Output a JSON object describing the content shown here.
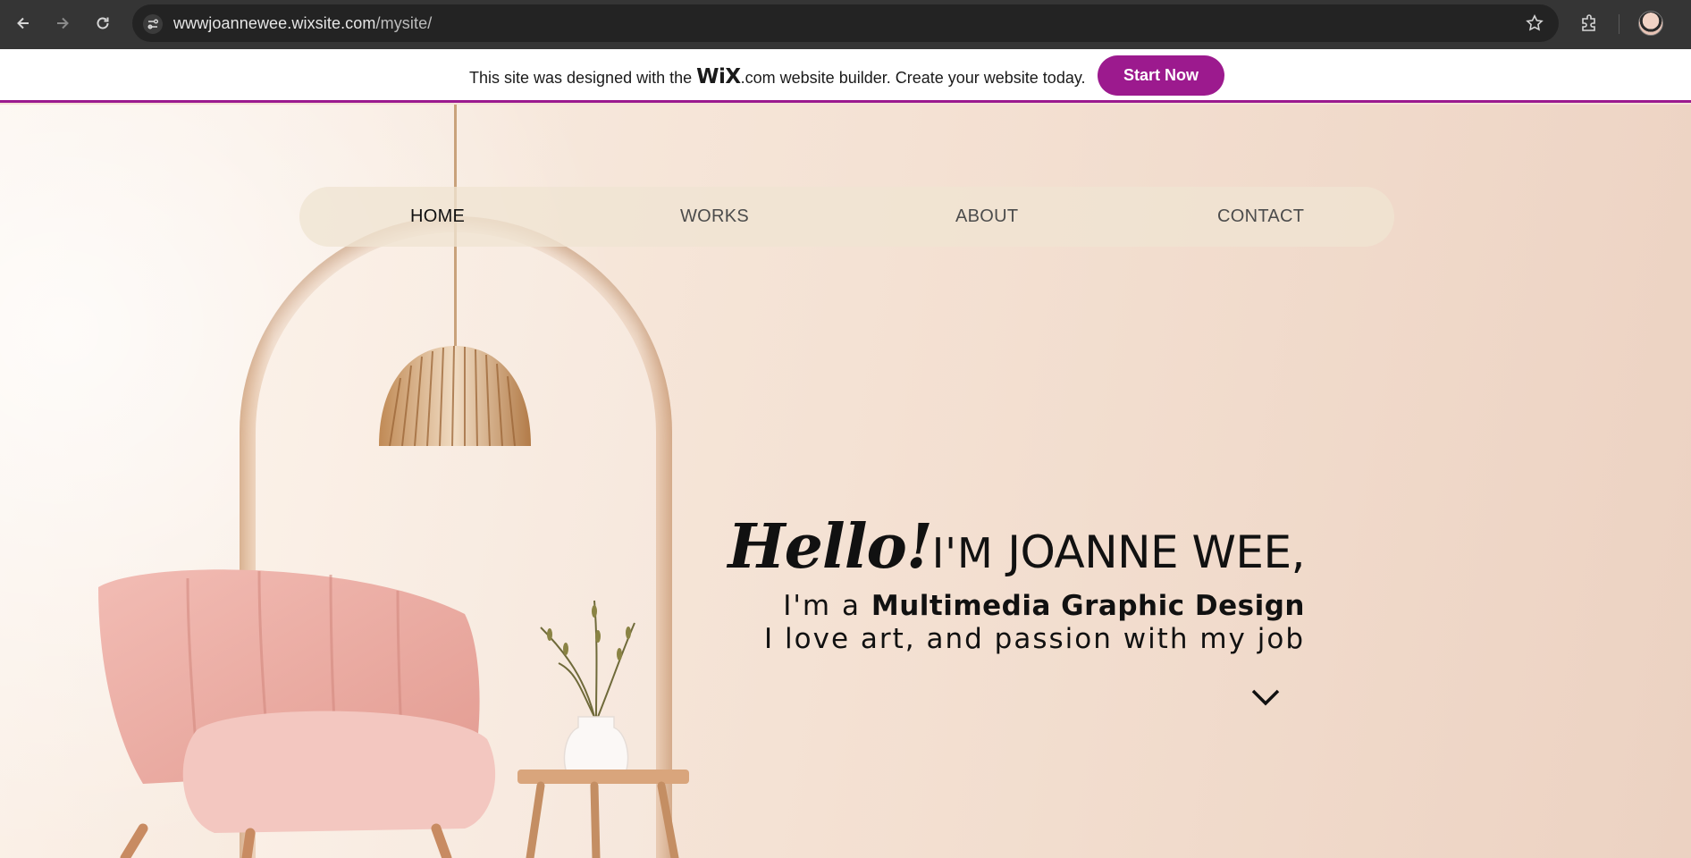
{
  "browser": {
    "url_domain": "wwwjoannewee.wixsite.com",
    "url_path": "/mysite/",
    "icons": [
      "back-icon",
      "forward-icon",
      "reload-icon",
      "site-info-icon",
      "bookmark-star-icon",
      "extensions-icon",
      "profile-avatar"
    ]
  },
  "wix_banner": {
    "text_before": "This site was designed with the ",
    "logo_main": "WiX",
    "logo_suffix": ".com",
    "text_after": " website builder. Create your website today.",
    "button_label": "Start Now",
    "accent_color": "#9c1a8e"
  },
  "nav": {
    "items": [
      {
        "label": "HOME",
        "active": true
      },
      {
        "label": "WORKS"
      },
      {
        "label": "ABOUT"
      },
      {
        "label": "CONTACT"
      }
    ]
  },
  "hero": {
    "hello": "Hello!",
    "im": "I'M ",
    "name": "JOANNE WEE,",
    "line1_prefix": "I'm a ",
    "line1_bold": "Multimedia Graphic Design",
    "line2": "I love art, and passion with my job",
    "scroll_icon": "chevron-down-icon"
  }
}
